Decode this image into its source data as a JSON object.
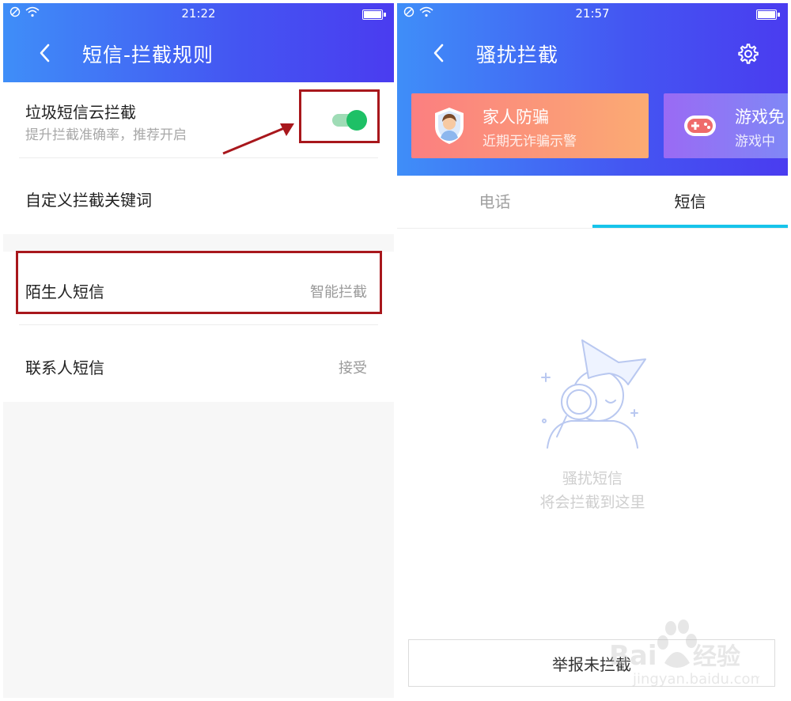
{
  "left_screen": {
    "status_time": "21:22",
    "title": "短信-拦截规则",
    "rows": {
      "cloud": {
        "title": "垃圾短信云拦截",
        "subtitle": "提升拦截准确率，推荐开启",
        "enabled": true
      },
      "keywords": {
        "title": "自定义拦截关键词"
      },
      "stranger": {
        "title": "陌生人短信",
        "value": "智能拦截"
      },
      "contact": {
        "title": "联系人短信",
        "value": "接受"
      }
    }
  },
  "right_screen": {
    "status_time": "21:57",
    "title": "骚扰拦截",
    "cards": [
      {
        "title": "家人防骗",
        "subtitle": "近期无诈骗示警"
      },
      {
        "title": "游戏免",
        "subtitle": "游戏中"
      }
    ],
    "tabs": [
      {
        "label": "电话",
        "active": false
      },
      {
        "label": "短信",
        "active": true
      }
    ],
    "empty": {
      "line1": "骚扰短信",
      "line2": "将会拦截到这里"
    },
    "report_button": "举报未拦截"
  },
  "colors": {
    "header_gradient_start": "#3f8ef8",
    "header_gradient_end": "#4a3cf0",
    "switch_on": "#1ec066",
    "highlight": "#a8171c",
    "tab_indicator": "#17c4ea",
    "card_family": "#fa8a7b",
    "card_game": "#8d6cf2"
  },
  "icons": [
    "wifi-icon",
    "no-sim-icon",
    "battery-icon",
    "back-icon",
    "gear-icon",
    "shield-family-icon",
    "gamepad-icon",
    "search-illustration-icon"
  ]
}
